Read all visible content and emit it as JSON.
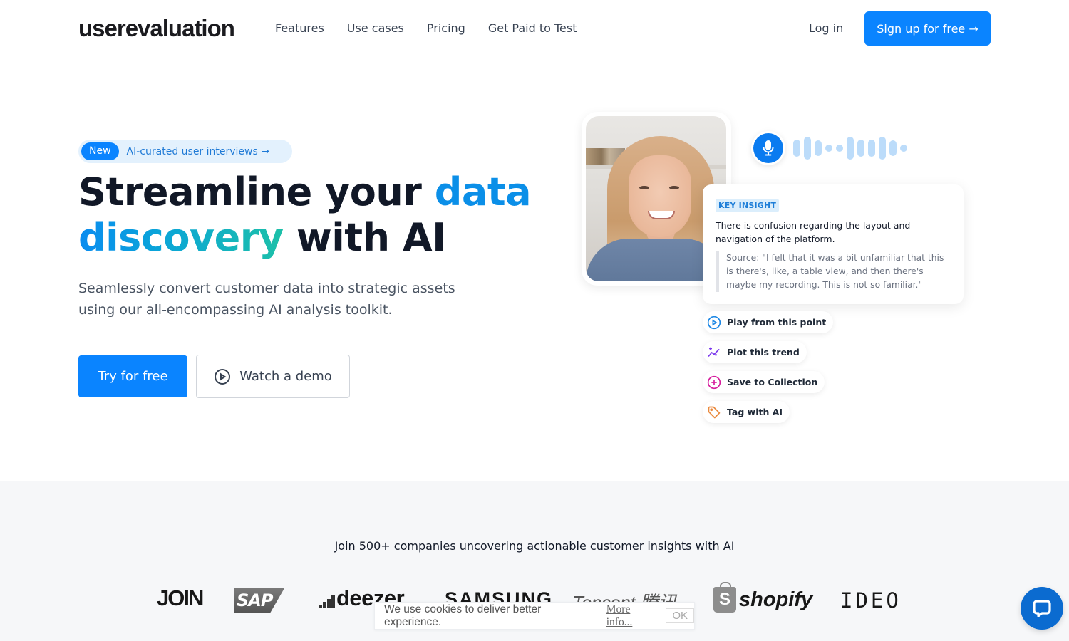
{
  "nav": {
    "logo": "userevaluation",
    "links": [
      "Features",
      "Use cases",
      "Pricing",
      "Get Paid to Test"
    ],
    "login": "Log in",
    "signup": "Sign up for free →"
  },
  "hero": {
    "pill": {
      "badge": "New",
      "text": "AI-curated user interviews →"
    },
    "headline": {
      "part1": "Streamline your ",
      "highlight1": "data",
      "highlight2": "discovery",
      "part2": " with AI"
    },
    "subtitle": "Seamlessly convert customer data into strategic assets using our all-encompassing AI analysis toolkit.",
    "cta_primary": "Try for free",
    "cta_secondary": "Watch a demo"
  },
  "visual": {
    "insight": {
      "badge": "KEY INSIGHT",
      "title": "There is confusion regarding the layout and navigation of the platform.",
      "quote": "Source: \"I felt that it was a bit unfamiliar that this is there's, like, a table view, and then there's maybe my recording. This is not so familiar.\""
    },
    "actions": [
      {
        "label": "Play from this point",
        "icon": "play-circle-icon",
        "color": "#1e88e5"
      },
      {
        "label": "Plot this trend",
        "icon": "sparkle-trend-icon",
        "color": "#7c3aed"
      },
      {
        "label": "Save to Collection",
        "icon": "plus-circle-icon",
        "color": "#d61f9e"
      },
      {
        "label": "Tag with AI",
        "icon": "tag-icon",
        "color": "#ea8a3e"
      }
    ]
  },
  "social_proof": {
    "headline": "Join 500+ companies uncovering actionable customer insights with AI",
    "logos": [
      "JOIN",
      "SAP",
      "deezer",
      "SAMSUNG",
      "Tencent 腾讯",
      "shopify",
      "IDEO"
    ]
  },
  "cookie": {
    "text": "We use cookies to deliver better experience.",
    "more": "More info...",
    "ok": "OK"
  },
  "colors": {
    "primary": "#0a84ff",
    "gradient_start": "#0a8cf0",
    "gradient_end": "#1dc0a8",
    "section_bg": "#f6f7f9"
  }
}
